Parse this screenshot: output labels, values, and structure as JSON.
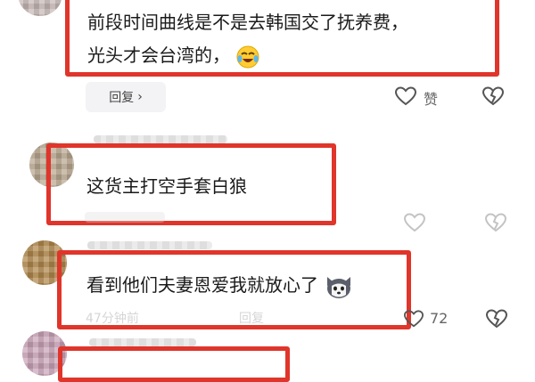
{
  "comments": [
    {
      "lines": [
        "前段时间曲线是不是去韩国交了抚养费，",
        "光头才会台湾的，"
      ],
      "emoji": "laughing-crying-emoji",
      "reply_label": "回复",
      "like_label": "赞"
    },
    {
      "text": "这货主打空手套白狼"
    },
    {
      "text": "看到他们夫妻恩爱我就放心了",
      "emoji": "husky-dog-emoji",
      "time": "47分钟前",
      "reply_label": "回复",
      "like_count": "72"
    }
  ],
  "colors": {
    "highlight_border": "#e0352b"
  }
}
